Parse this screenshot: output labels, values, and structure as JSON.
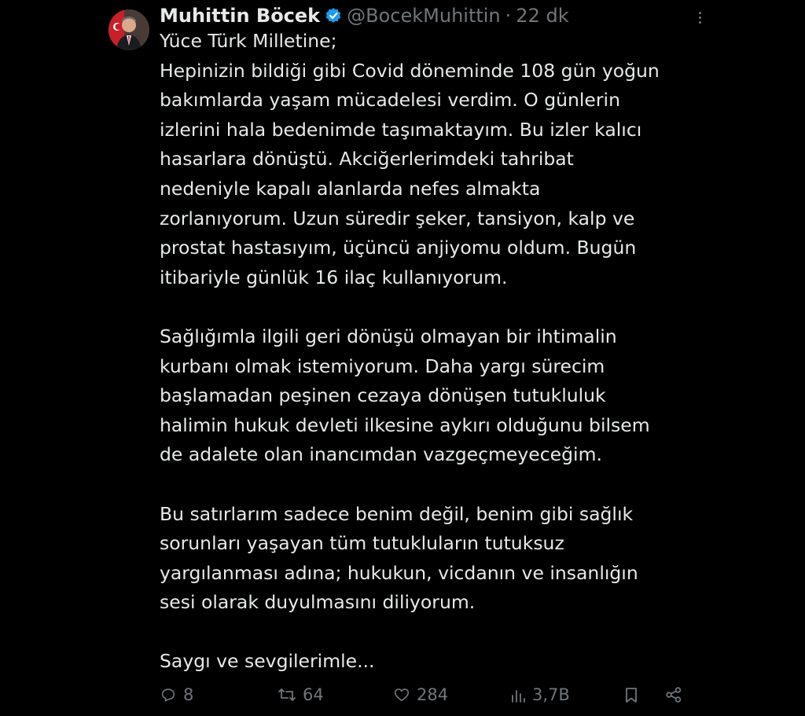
{
  "tweet": {
    "author_name": "Muhittin Böcek",
    "handle": "@BocekMuhittin",
    "separator": "·",
    "time": "22 dk",
    "verified": true,
    "accent_color": "#1d9bf0",
    "body_lines": [
      "Yüce Türk Milletine;",
      "Hepinizin bildiği gibi Covid döneminde 108 gün yoğun",
      "bakımlarda yaşam mücadelesi verdim. O günlerin",
      "izlerini hala bedenimde taşımaktayım. Bu izler kalıcı",
      "hasarlara dönüştü. Akciğerlerimdeki tahribat",
      "nedeniyle kapalı alanlarda nefes almakta",
      "zorlanıyorum. Uzun süredir şeker, tansiyon, kalp ve",
      "prostat hastasıyım, üçüncü anjiyomu oldum. Bugün",
      "itibariyle günlük 16 ilaç kullanıyorum.",
      "",
      "Sağlığımla ilgili geri dönüşü olmayan bir ihtimalin",
      "kurbanı olmak istemiyorum. Daha yargı sürecim",
      "başlamadan peşinen cezaya dönüşen tutukluluk",
      "halimin hukuk devleti ilkesine aykırı olduğunu bilsem",
      "de adalete olan inancımdan vazgeçmeyeceğim.",
      "",
      "Bu satırlarım sadece benim değil, benim gibi sağlık",
      "sorunları yaşayan tüm tutukluların tutuksuz",
      "yargılanması adına; hukukun, vicdanın ve insanlığın",
      "sesi olarak duyulmasını diliyorum.",
      "",
      "Saygı ve sevgilerimle..."
    ],
    "actions": {
      "replies": {
        "icon": "reply-icon",
        "count": "8"
      },
      "reposts": {
        "icon": "repost-icon",
        "count": "64"
      },
      "likes": {
        "icon": "heart-icon",
        "count": "284"
      },
      "views": {
        "icon": "views-icon",
        "count": "3,7B"
      },
      "bookmark": {
        "icon": "bookmark-icon"
      },
      "share": {
        "icon": "share-icon"
      }
    },
    "more_icon": "more-icon"
  }
}
